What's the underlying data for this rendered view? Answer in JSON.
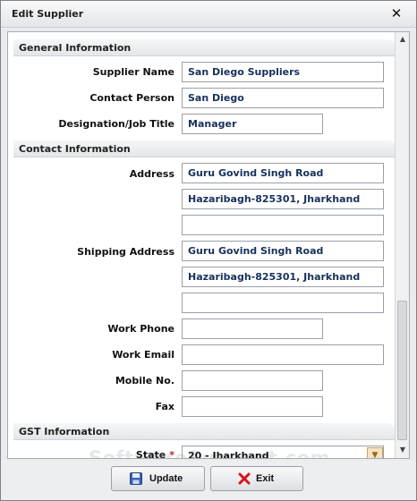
{
  "dialog": {
    "title": "Edit Supplier",
    "close_glyph": "✕"
  },
  "sections": {
    "general": "General Information",
    "contact": "Contact Information",
    "gst": "GST Information"
  },
  "labels": {
    "supplier_name": "Supplier Name",
    "contact_person": "Contact Person",
    "designation": "Designation/Job Title",
    "address": "Address",
    "shipping_address": "Shipping Address",
    "work_phone": "Work Phone",
    "work_email": "Work Email",
    "mobile": "Mobile No.",
    "fax": "Fax",
    "state": "State",
    "required_mark": "*"
  },
  "values": {
    "supplier_name": "San Diego Suppliers",
    "contact_person": "San Diego",
    "designation": "Manager",
    "address_line1": "Guru Govind Singh Road",
    "address_line2": "Hazaribagh-825301, Jharkhand",
    "address_line3": "",
    "shipping_line1": "Guru Govind Singh Road",
    "shipping_line2": "Hazaribagh-825301, Jharkhand",
    "shipping_line3": "",
    "work_phone": "",
    "work_email": "",
    "mobile": "",
    "fax": "",
    "state": "20 - Jharkhand"
  },
  "buttons": {
    "update": "Update",
    "exit": "Exit"
  },
  "watermark": "SoftwareSuggest.com",
  "icons": {
    "close": "close-icon",
    "update": "floppy-disk-icon",
    "exit": "red-x-icon",
    "state_dropdown": "folder-icon"
  },
  "colors": {
    "field_text": "#17315c",
    "required": "#c0262c",
    "exit_icon": "#d4141a",
    "update_icon": "#3a62b8"
  }
}
